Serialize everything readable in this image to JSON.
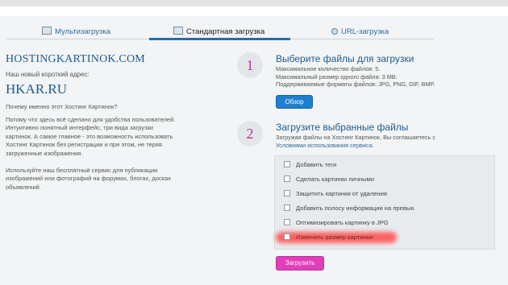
{
  "tabs": [
    {
      "label": "Мультизагрузка",
      "icon": "image-stack-icon",
      "active": false
    },
    {
      "label": "Стандартная загрузка",
      "icon": "picture-icon",
      "active": true
    },
    {
      "label": "URL-загрузка",
      "icon": "globe-icon",
      "active": false
    }
  ],
  "left": {
    "brand": "HOSTINGKARTINOK.COM",
    "short_address_label": "Наш новый короткий адрес:",
    "short_address": "HKAR.RU",
    "why_heading": "Почему именно этот Хостинг Картинок?",
    "why_text": "Потому что здесь всё сделано для удобства пользователей. Интуитивно понятный интерфейс, три вида загрузки картинок. А самое главное - это возможность использовать Хостинг Картинок без регистрации и при этом, не теряя загруженные изображения.",
    "usage_text": "Используйте наш бесплатный сервис для публикации изображений или фотографий на форумах, блогах, досках объявлений."
  },
  "step1": {
    "number": "1",
    "title": "Выберите файлы для загрузки",
    "max_files": "Максимальное количество файлов: 5.",
    "max_size": "Максимальный размер одного файла: 3 MB.",
    "formats": "Поддерживаемые форматы файлов: JPG, PNG, GIF, BMP.",
    "browse_button": "Обзор"
  },
  "step2": {
    "number": "2",
    "title": "Загрузите выбранные файлы",
    "agree_text": "Загружая файлы на Хостинг Картинок, Вы соглашаетесь с",
    "terms_link": "Условиями использования сервиса.",
    "options": [
      "Добавить теги",
      "Сделать картинки личными",
      "Защитить картинки от удаления",
      "Добавить полосу информации на превью",
      "Оптимизировать картинку в JPG",
      "Изменить размер картинки"
    ],
    "upload_button": "Загрузить"
  },
  "colors": {
    "link_blue": "#1d5a8f",
    "browse_button": "#1e7fd0",
    "upload_button": "#e03fb9",
    "step_number": "#b0369a",
    "highlight": "#ff4a4a"
  }
}
